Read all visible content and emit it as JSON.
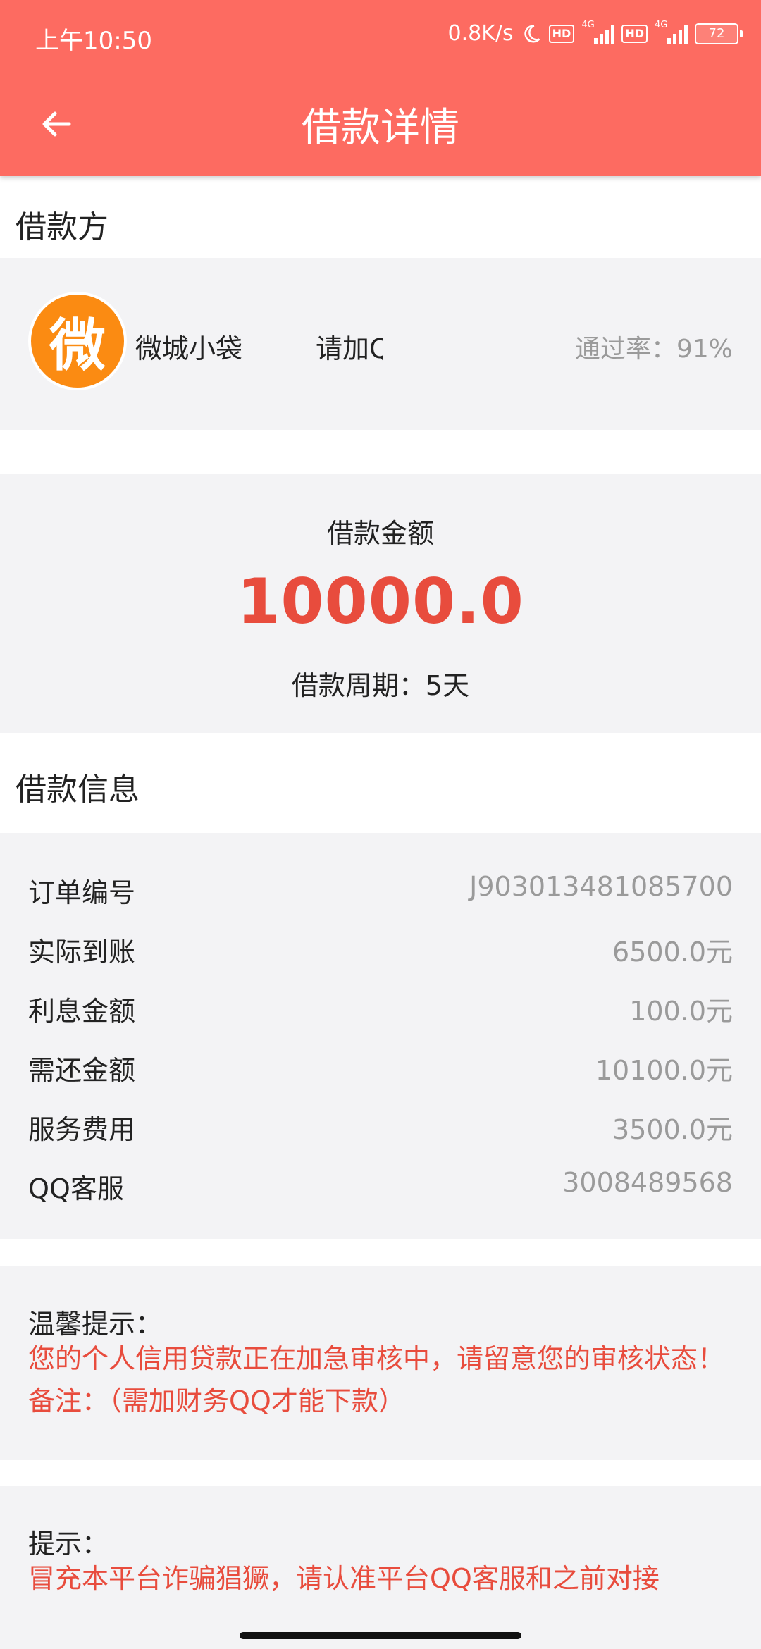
{
  "status_bar": {
    "time": "上午10:50",
    "speed": "0.8K/s",
    "hd_label": "HD",
    "network_label": "4G",
    "battery": "72"
  },
  "header": {
    "title": "借款详情"
  },
  "lender": {
    "section_title": "借款方",
    "logo_char": "微",
    "name": "微城小袋",
    "add_text": "请加QQ",
    "pass_rate": "通过率：91%"
  },
  "loan": {
    "amount_label": "借款金额",
    "amount": "10000.0",
    "period": "借款周期：5天"
  },
  "info": {
    "section_title": "借款信息",
    "rows": [
      {
        "key": "订单编号",
        "value": "J903013481085700"
      },
      {
        "key": "实际到账",
        "value": "6500.0元"
      },
      {
        "key": "利息金额",
        "value": "100.0元"
      },
      {
        "key": "需还金额",
        "value": "10100.0元"
      },
      {
        "key": "服务费用",
        "value": "3500.0元"
      },
      {
        "key": "QQ客服",
        "value": "3008489568"
      }
    ]
  },
  "notice": {
    "title": "温馨提示：",
    "text": "您的个人信用贷款正在加急审核中，请留意您的审核状态！备注：（需加财务QQ才能下款）"
  },
  "tip": {
    "title": "提示：",
    "text": "冒充本平台诈骗猖獗，请认准平台QQ客服和之前对接"
  },
  "colors": {
    "accent": "#fd6b61",
    "amount": "#e84c3d",
    "logo": "#fb8b12"
  }
}
